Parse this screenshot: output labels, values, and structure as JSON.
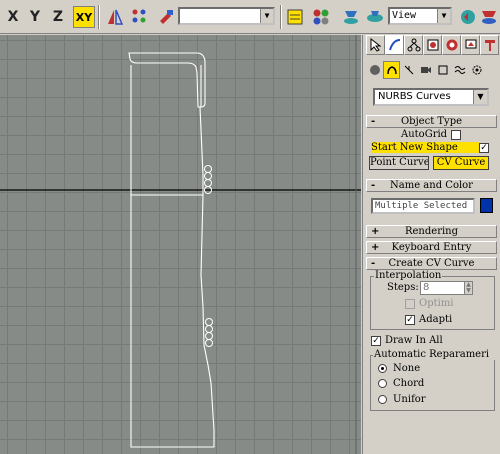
{
  "toolbar": {
    "axis_x": "X",
    "axis_y": "Y",
    "axis_z": "Z",
    "axis_xy": "XY",
    "selection_set_value": "",
    "view_dropdown": "View"
  },
  "panel": {
    "object_category": "NURBS Curves",
    "rollouts": {
      "object_type": "Object Type",
      "name_and_color": "Name and Color",
      "rendering": "Rendering",
      "keyboard_entry": "Keyboard Entry",
      "create_cv_curve": "Create CV Curve"
    },
    "object_type": {
      "autogrid_label": "AutoGrid",
      "start_new_shape_label": "Start New Shape",
      "point_curve_button": "Point Curve",
      "cv_curve_button": "CV Curve"
    },
    "name_field": "Multiple Selected",
    "interpolation": {
      "group_label": "Interpolation",
      "steps_label": "Steps:",
      "steps_value": "8",
      "optimize_label": "Optimi",
      "adaptive_label": "Adapti"
    },
    "draw_in_all_label": "Draw In All",
    "reparam": {
      "group_label": "Automatic Reparameri",
      "none_label": "None",
      "chord_label": "Chord",
      "uniform_label": "Unifor"
    },
    "sign_minus": "-",
    "sign_plus": "+"
  },
  "colors": {
    "accent": "#ffe100",
    "viewport_bg": "#878b87",
    "swatch": "#0033aa"
  }
}
